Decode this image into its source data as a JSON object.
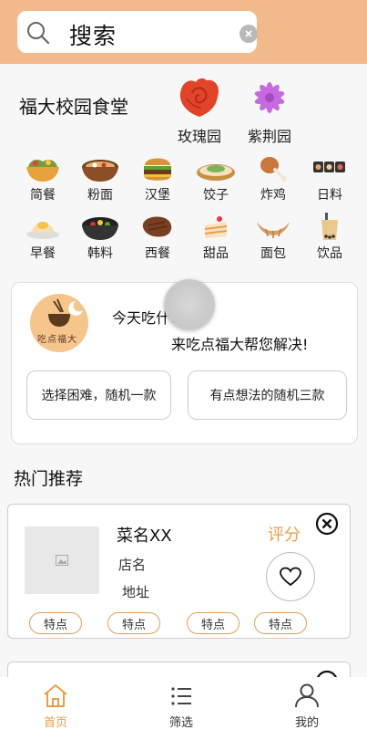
{
  "search": {
    "query": "搜索"
  },
  "campus": {
    "title": "福大校园食堂",
    "canteens": [
      {
        "label": "玫瑰园",
        "icon": "rose-icon"
      },
      {
        "label": "紫荆园",
        "icon": "bauhinia-icon"
      }
    ]
  },
  "categories": [
    {
      "label": "简餐",
      "icon": "rice-bowl-icon"
    },
    {
      "label": "粉面",
      "icon": "noodle-bowl-icon"
    },
    {
      "label": "汉堡",
      "icon": "burger-icon"
    },
    {
      "label": "饺子",
      "icon": "dumpling-icon"
    },
    {
      "label": "炸鸡",
      "icon": "fried-chicken-icon"
    },
    {
      "label": "日料",
      "icon": "sushi-icon"
    },
    {
      "label": "早餐",
      "icon": "breakfast-icon"
    },
    {
      "label": "韩料",
      "icon": "bibimbap-icon"
    },
    {
      "label": "西餐",
      "icon": "steak-icon"
    },
    {
      "label": "甜品",
      "icon": "cake-icon"
    },
    {
      "label": "面包",
      "icon": "croissant-icon"
    },
    {
      "label": "饮品",
      "icon": "bubble-tea-icon"
    }
  ],
  "random": {
    "logo_text": "吃点福大",
    "question": "今天吃什么?",
    "answer": "来吃点福大帮您解决!",
    "btn_one": "选择困难，随机一款",
    "btn_three": "有点想法的随机三款"
  },
  "hot": {
    "title": "热门推荐",
    "dish": {
      "name": "菜名XX",
      "shop": "店名",
      "address": "地址",
      "score_label": "评分",
      "tags": [
        "特点",
        "特点",
        "特点",
        "特点"
      ]
    }
  },
  "nav": {
    "items": [
      {
        "label": "首页",
        "icon": "home-icon",
        "active": true
      },
      {
        "label": "筛选",
        "icon": "list-icon",
        "active": false
      },
      {
        "label": "我的",
        "icon": "user-icon",
        "active": false
      }
    ]
  },
  "colors": {
    "header": "#f2b98a",
    "accent": "#e9a04b",
    "nav_active": "#e9a04b"
  }
}
